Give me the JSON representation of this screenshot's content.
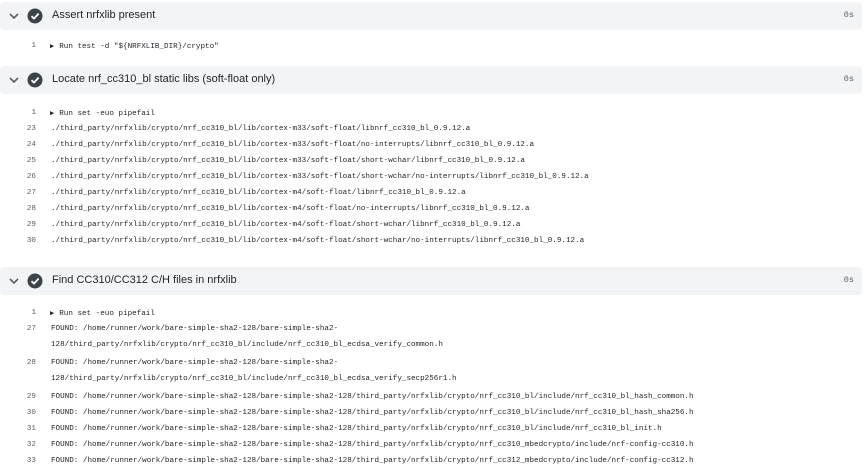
{
  "steps": [
    {
      "title": "Assert nrfxlib present",
      "duration": "0s",
      "lines": [
        {
          "n": "1",
          "cmd": true,
          "text": "Run test -d \"${NRFXLIB_DIR}/crypto\""
        }
      ]
    },
    {
      "title": "Locate nrf_cc310_bl static libs (soft-float only)",
      "duration": "0s",
      "lines": [
        {
          "n": "1",
          "cmd": true,
          "text": "Run set -euo pipefail"
        },
        {
          "n": "23",
          "text": "./third_party/nrfxlib/crypto/nrf_cc310_bl/lib/cortex-m33/soft-float/libnrf_cc310_bl_0.9.12.a"
        },
        {
          "n": "24",
          "text": "./third_party/nrfxlib/crypto/nrf_cc310_bl/lib/cortex-m33/soft-float/no-interrupts/libnrf_cc310_bl_0.9.12.a"
        },
        {
          "n": "25",
          "text": "./third_party/nrfxlib/crypto/nrf_cc310_bl/lib/cortex-m33/soft-float/short-wchar/libnrf_cc310_bl_0.9.12.a"
        },
        {
          "n": "26",
          "text": "./third_party/nrfxlib/crypto/nrf_cc310_bl/lib/cortex-m33/soft-float/short-wchar/no-interrupts/libnrf_cc310_bl_0.9.12.a"
        },
        {
          "n": "27",
          "text": "./third_party/nrfxlib/crypto/nrf_cc310_bl/lib/cortex-m4/soft-float/libnrf_cc310_bl_0.9.12.a"
        },
        {
          "n": "28",
          "text": "./third_party/nrfxlib/crypto/nrf_cc310_bl/lib/cortex-m4/soft-float/no-interrupts/libnrf_cc310_bl_0.9.12.a"
        },
        {
          "n": "29",
          "text": "./third_party/nrfxlib/crypto/nrf_cc310_bl/lib/cortex-m4/soft-float/short-wchar/libnrf_cc310_bl_0.9.12.a"
        },
        {
          "n": "30",
          "text": "./third_party/nrfxlib/crypto/nrf_cc310_bl/lib/cortex-m4/soft-float/short-wchar/no-interrupts/libnrf_cc310_bl_0.9.12.a"
        }
      ]
    },
    {
      "title": "Find CC310/CC312 C/H files in nrfxlib",
      "duration": "0s",
      "lines": [
        {
          "n": "1",
          "cmd": true,
          "text": "Run set -euo pipefail"
        },
        {
          "n": "27",
          "text": "FOUND: /home/runner/work/bare-simple-sha2-128/bare-simple-sha2-",
          "cont": "128/third_party/nrfxlib/crypto/nrf_cc310_bl/include/nrf_cc310_bl_ecdsa_verify_common.h"
        },
        {
          "n": "28",
          "text": "FOUND: /home/runner/work/bare-simple-sha2-128/bare-simple-sha2-",
          "cont": "128/third_party/nrfxlib/crypto/nrf_cc310_bl/include/nrf_cc310_bl_ecdsa_verify_secp256r1.h"
        },
        {
          "n": "29",
          "text": "FOUND: /home/runner/work/bare-simple-sha2-128/bare-simple-sha2-128/third_party/nrfxlib/crypto/nrf_cc310_bl/include/nrf_cc310_bl_hash_common.h"
        },
        {
          "n": "30",
          "text": "FOUND: /home/runner/work/bare-simple-sha2-128/bare-simple-sha2-128/third_party/nrfxlib/crypto/nrf_cc310_bl/include/nrf_cc310_bl_hash_sha256.h"
        },
        {
          "n": "31",
          "text": "FOUND: /home/runner/work/bare-simple-sha2-128/bare-simple-sha2-128/third_party/nrfxlib/crypto/nrf_cc310_bl/include/nrf_cc310_bl_init.h"
        },
        {
          "n": "32",
          "text": "FOUND: /home/runner/work/bare-simple-sha2-128/bare-simple-sha2-128/third_party/nrfxlib/crypto/nrf_cc310_mbedcrypto/include/nrf-config-cc310.h"
        },
        {
          "n": "33",
          "text": "FOUND: /home/runner/work/bare-simple-sha2-128/bare-simple-sha2-128/third_party/nrfxlib/crypto/nrf_cc312_mbedcrypto/include/nrf-config-cc312.h"
        }
      ]
    }
  ]
}
